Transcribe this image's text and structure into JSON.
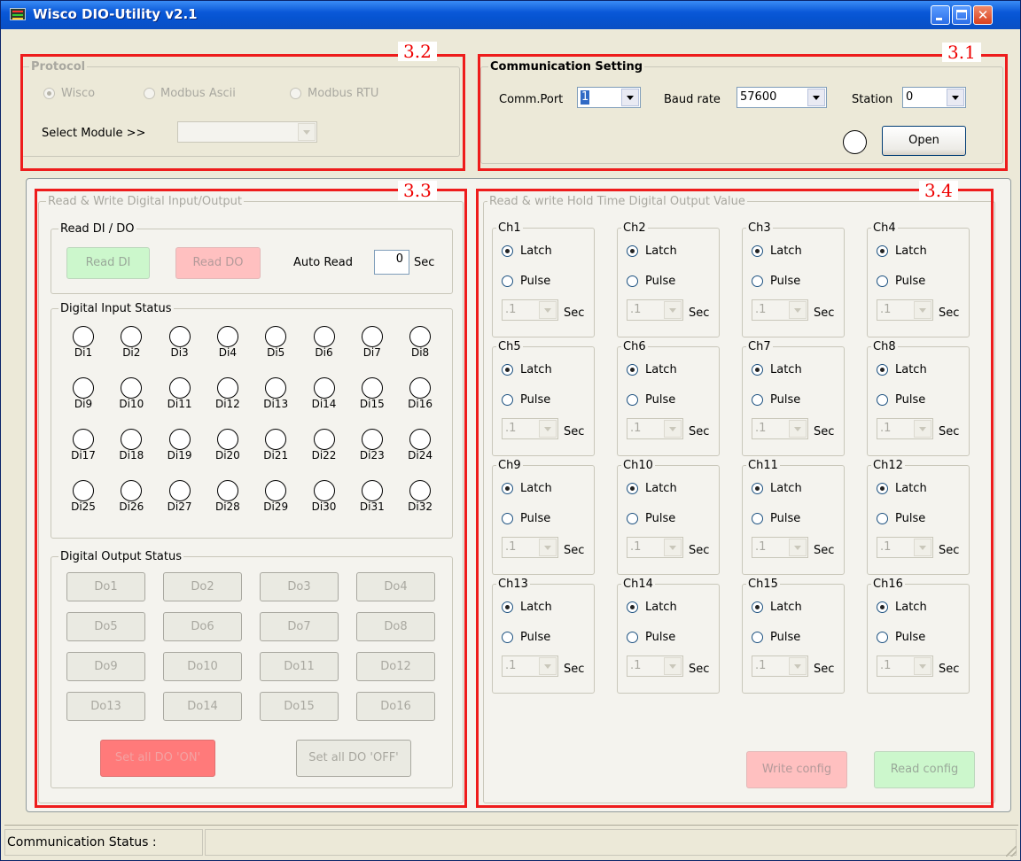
{
  "window": {
    "title": "Wisco DIO-Utility v2.1"
  },
  "annotations": {
    "s31": "3.1",
    "s32": "3.2",
    "s33": "3.3",
    "s34": "3.4"
  },
  "protocol": {
    "title": "Protocol",
    "options": [
      "Wisco",
      "Modbus Ascii",
      "Modbus RTU"
    ],
    "selected": "Wisco",
    "select_module_label": "Select Module >>",
    "select_module_value": ""
  },
  "comm": {
    "title": "Communication Setting",
    "port_label": "Comm.Port",
    "port_value": "1",
    "baud_label": "Baud rate",
    "baud_value": "57600",
    "station_label": "Station",
    "station_value": "0",
    "open_label": "Open"
  },
  "rw_io": {
    "title": "Read & Write Digital Input/Output",
    "read_group": "Read DI / DO",
    "read_di": "Read DI",
    "read_do": "Read DO",
    "auto_read_label": "Auto Read",
    "auto_read_value": "0",
    "sec": "Sec",
    "di_group": "Digital Input Status",
    "di_labels": [
      "Di1",
      "Di2",
      "Di3",
      "Di4",
      "Di5",
      "Di6",
      "Di7",
      "Di8",
      "Di9",
      "Di10",
      "Di11",
      "Di12",
      "Di13",
      "Di14",
      "Di15",
      "Di16",
      "Di17",
      "Di18",
      "Di19",
      "Di20",
      "Di21",
      "Di22",
      "Di23",
      "Di24",
      "Di25",
      "Di26",
      "Di27",
      "Di28",
      "Di29",
      "Di30",
      "Di31",
      "Di32"
    ],
    "do_group": "Digital Output Status",
    "do_labels": [
      "Do1",
      "Do2",
      "Do3",
      "Do4",
      "Do5",
      "Do6",
      "Do7",
      "Do8",
      "Do9",
      "Do10",
      "Do11",
      "Do12",
      "Do13",
      "Do14",
      "Do15",
      "Do16"
    ],
    "set_all_on": "Set all DO 'ON'",
    "set_all_off": "Set all DO 'OFF'"
  },
  "hold": {
    "title": "Read & write Hold Time Digital Output Value",
    "channels": [
      "Ch1",
      "Ch2",
      "Ch3",
      "Ch4",
      "Ch5",
      "Ch6",
      "Ch7",
      "Ch8",
      "Ch9",
      "Ch10",
      "Ch11",
      "Ch12",
      "Ch13",
      "Ch14",
      "Ch15",
      "Ch16"
    ],
    "latch": "Latch",
    "pulse": "Pulse",
    "time_value": ".1",
    "sec": "Sec",
    "write_config": "Write config",
    "read_config": "Read config"
  },
  "status": {
    "label": "Communication Status :",
    "value": ""
  }
}
